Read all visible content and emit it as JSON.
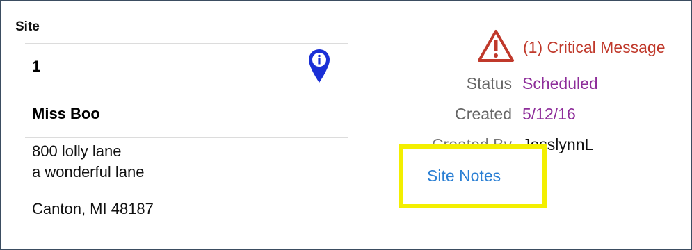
{
  "site_section": {
    "header": "Site",
    "site_number": "1",
    "site_name": "Miss Boo",
    "address_line1": "800 lolly lane",
    "address_line2": "a wonderful lane",
    "city_state_zip": "Canton, MI 48187",
    "info_icon": "info-location-pin-icon"
  },
  "details": {
    "critical_message": "(1) Critical Message",
    "warning_icon": "warning-triangle-icon",
    "status_label": "Status",
    "status_value": "Scheduled",
    "created_label": "Created",
    "created_value": "5/12/16",
    "created_by_label": "Created By",
    "created_by_value": "JesslynnL",
    "site_notes_link": "Site Notes"
  },
  "colors": {
    "critical": "#c0392b",
    "status": "#8e2d9a",
    "link": "#2a7fd4",
    "highlight": "#f3ef00",
    "pin": "#1a2fd6"
  }
}
